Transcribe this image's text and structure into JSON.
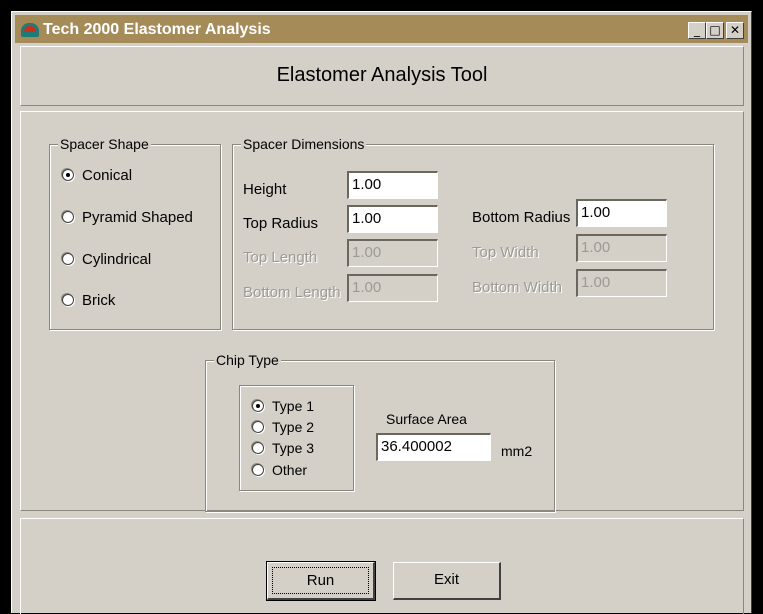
{
  "window": {
    "title": "Tech 2000 Elastomer Analysis",
    "controls": {
      "minimize": "_",
      "maximize": "□",
      "close": "✕"
    }
  },
  "header": {
    "title": "Elastomer Analysis Tool"
  },
  "spacer_shape": {
    "legend": "Spacer Shape",
    "options": [
      {
        "label": "Conical",
        "checked": true
      },
      {
        "label": "Pyramid Shaped",
        "checked": false
      },
      {
        "label": "Cylindrical",
        "checked": false
      },
      {
        "label": "Brick",
        "checked": false
      }
    ]
  },
  "spacer_dimensions": {
    "legend": "Spacer Dimensions",
    "height": {
      "label": "Height",
      "value": "1.00"
    },
    "top_radius": {
      "label": "Top Radius",
      "value": "1.00"
    },
    "top_length": {
      "label": "Top Length",
      "value": "1.00"
    },
    "bottom_length": {
      "label": "Bottom Length",
      "value": "1.00"
    },
    "bottom_radius": {
      "label": "Bottom Radius",
      "value": "1.00"
    },
    "top_width": {
      "label": "Top Width",
      "value": "1.00"
    },
    "bottom_width": {
      "label": "Bottom Width",
      "value": "1.00"
    }
  },
  "chip_type": {
    "legend": "Chip Type",
    "options": [
      {
        "label": "Type 1",
        "checked": true
      },
      {
        "label": "Type 2",
        "checked": false
      },
      {
        "label": "Type 3",
        "checked": false
      },
      {
        "label": "Other",
        "checked": false
      }
    ],
    "surface_area": {
      "label": "Surface Area",
      "value": "36.400002",
      "unit": "mm2"
    }
  },
  "buttons": {
    "run": "Run",
    "exit": "Exit"
  },
  "colors": {
    "titlebar": "#a58b58",
    "face": "#d4d0c8",
    "background": "#000000"
  }
}
